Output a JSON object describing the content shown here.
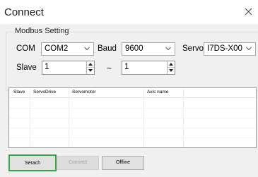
{
  "window": {
    "title": "Connect"
  },
  "modbus": {
    "legend": "Modbus Setting",
    "com_label": "COM",
    "com_value": "COM2",
    "baud_label": "Baud",
    "baud_value": "9600",
    "servo_label": "Servo",
    "servo_value": "I7DS-X00",
    "slave_label": "Slave",
    "slave_from": "1",
    "range_sep": "~",
    "slave_to": "1"
  },
  "table": {
    "columns": [
      "Slave",
      "ServoDrive",
      "Servomotor",
      "Axis name"
    ]
  },
  "buttons": {
    "search": "Serach",
    "connect": "Connect",
    "offline": "Offline"
  },
  "colors": {
    "focus_border": "#39a64a",
    "window_bg": "#f0f0f0"
  }
}
